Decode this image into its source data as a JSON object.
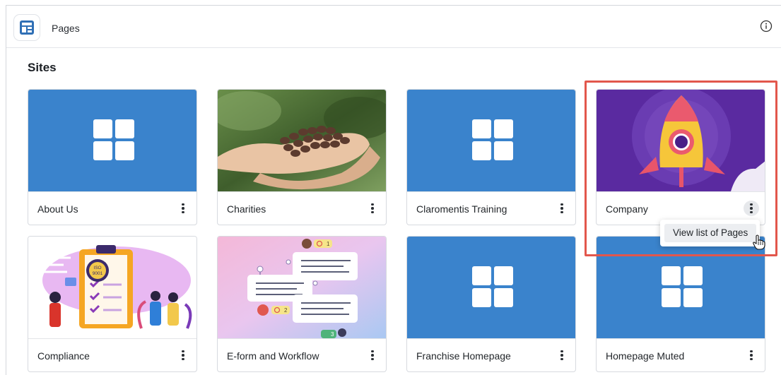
{
  "header": {
    "title": "Pages"
  },
  "section": {
    "title": "Sites"
  },
  "cards": [
    {
      "label": "About Us",
      "thumb": "blue-grid"
    },
    {
      "label": "Charities",
      "thumb": "hands-beans-photo"
    },
    {
      "label": "Claromentis Training",
      "thumb": "blue-grid"
    },
    {
      "label": "Company",
      "thumb": "rocket-illustration"
    },
    {
      "label": "Compliance",
      "thumb": "clipboard-iso-illustration"
    },
    {
      "label": "E-form and Workflow",
      "thumb": "workflow-illustration"
    },
    {
      "label": "Franchise Homepage",
      "thumb": "blue-grid"
    },
    {
      "label": "Homepage Muted",
      "thumb": "blue-grid"
    }
  ],
  "menu": {
    "item": "View list of Pages"
  },
  "badges": {
    "workflow_a": "1",
    "workflow_b": "2",
    "workflow_c": "3",
    "iso": "ISO",
    "iso_num": "9001"
  },
  "colors": {
    "tile_blue": "#3a83cc",
    "highlight": "#e2574c",
    "rocket_bg": "#5a2aa0"
  }
}
